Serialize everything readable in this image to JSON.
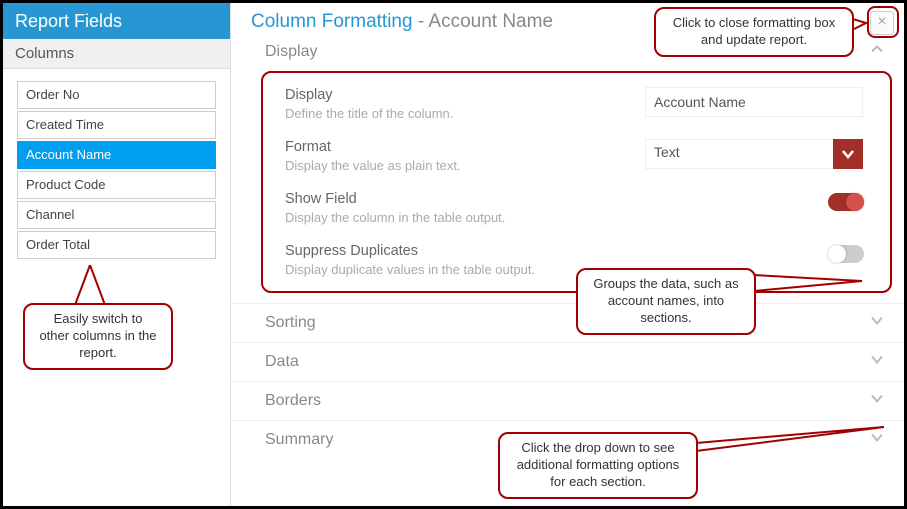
{
  "sidebar": {
    "header": "Report Fields",
    "sub": "Columns",
    "items": [
      {
        "label": "Order No"
      },
      {
        "label": "Created Time"
      },
      {
        "label": "Account Name",
        "active": true
      },
      {
        "label": "Product Code"
      },
      {
        "label": "Channel"
      },
      {
        "label": "Order Total"
      }
    ]
  },
  "main": {
    "title_blue": "Column Formatting",
    "title_sep": " - ",
    "title_grey": "Account Name"
  },
  "display_section": {
    "header": "Display",
    "rows": {
      "display": {
        "label": "Display",
        "desc": "Define the title of the column.",
        "value": "Account Name"
      },
      "format": {
        "label": "Format",
        "desc": "Display the value as plain text.",
        "value": "Text"
      },
      "show_field": {
        "label": "Show Field",
        "desc": "Display the column in the table output."
      },
      "suppress": {
        "label": "Suppress Duplicates",
        "desc": "Display duplicate values in the table output."
      }
    }
  },
  "sections": {
    "sorting": "Sorting",
    "data": "Data",
    "borders": "Borders",
    "summary": "Summary"
  },
  "callouts": {
    "close": "Click to close formatting box and update report.",
    "suppress": "Groups the data, such as account names, into sections.",
    "sidebar": "Easily switch to other columns in the report.",
    "section": "Click the drop down to see additional formatting options for each section."
  }
}
